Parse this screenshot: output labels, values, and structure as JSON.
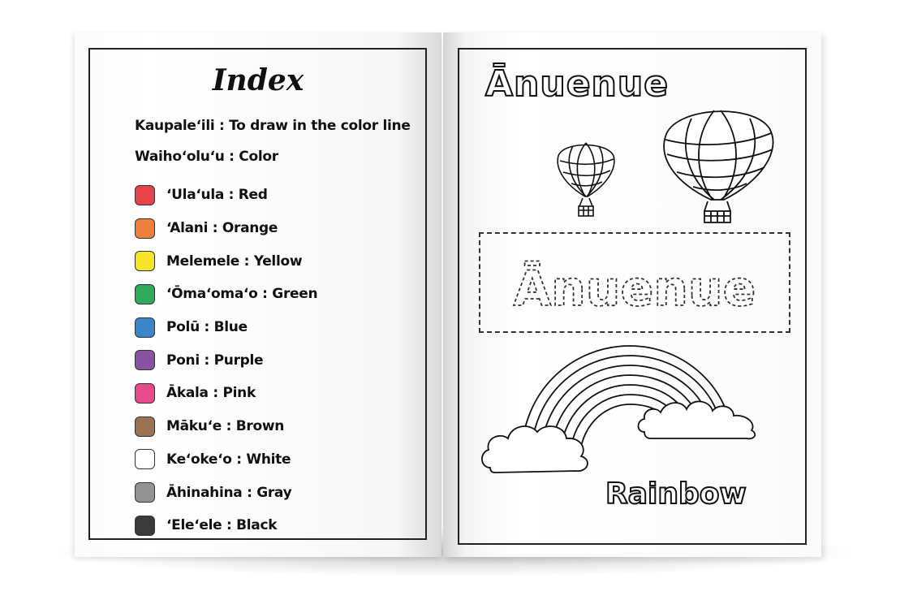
{
  "left_page": {
    "title": "Index",
    "definitions": [
      "Kaupaleʻili : To draw in the color line",
      "Waihoʻoluʻu : Color"
    ],
    "colors": [
      {
        "label": "ʻUlaʻula : Red",
        "hex": "#e8424b"
      },
      {
        "label": "ʻAlani : Orange",
        "hex": "#f07f3c"
      },
      {
        "label": "Melemele : Yellow",
        "hex": "#f7e52a"
      },
      {
        "label": "ʻŌmaʻomaʻo : Green",
        "hex": "#2eaa5a"
      },
      {
        "label": "Polū : Blue",
        "hex": "#3a86c8"
      },
      {
        "label": "Poni : Purple",
        "hex": "#8a52a3"
      },
      {
        "label": "Ākala : Pink",
        "hex": "#e84a8c"
      },
      {
        "label": "Mākuʻe : Brown",
        "hex": "#9b7352"
      },
      {
        "label": "Keʻokeʻo : White",
        "hex": "#ffffff"
      },
      {
        "label": "Āhinahina : Gray",
        "hex": "#939393"
      },
      {
        "label": "ʻEleʻele : Black",
        "hex": "#3a3a3a"
      }
    ]
  },
  "right_page": {
    "title": "Ānuenue",
    "trace_word": "Ānuenue",
    "caption": "Rainbow",
    "icons": [
      "hot-air-balloon-icon",
      "rainbow-icon",
      "cloud-icon"
    ]
  }
}
